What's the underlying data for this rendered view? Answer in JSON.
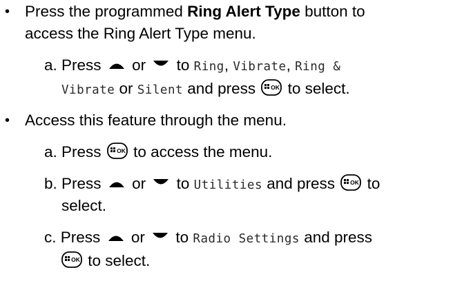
{
  "bullet_char": "•",
  "items": [
    {
      "pre": "Press the programmed ",
      "bold": "Ring Alert Type",
      "post1": " button to",
      "line2": "access the Ring Alert Type menu.",
      "sub": {
        "letter": "a.",
        "press": "Press",
        "or": "or",
        "to": "to",
        "opt1": "Ring",
        "comma1": ",",
        "opt2": "Vibrate",
        "comma2": ",",
        "opt3a": "Ring &",
        "opt3b": "Vibrate",
        "or2": "or",
        "opt4": "Silent",
        "and_press": "and press",
        "to_select": "to select."
      }
    },
    {
      "text": "Access this feature through the menu.",
      "subs": [
        {
          "letter": "a.",
          "press": "Press",
          "after": "to access the menu."
        },
        {
          "letter": "b.",
          "press": "Press",
          "or": "or",
          "to": "to",
          "target": "Utilities",
          "and_press": "and press",
          "to_word": "to",
          "line2": "select."
        },
        {
          "letter": "c.",
          "press": "Press",
          "or": "or",
          "to": "to",
          "target": "Radio Settings",
          "and_press": "and press",
          "to_select": "to select."
        }
      ]
    }
  ],
  "icons": {
    "up": "up-arrow-icon",
    "down": "down-arrow-icon",
    "ok": "menu-ok-button-icon",
    "ok_label": "OK"
  }
}
